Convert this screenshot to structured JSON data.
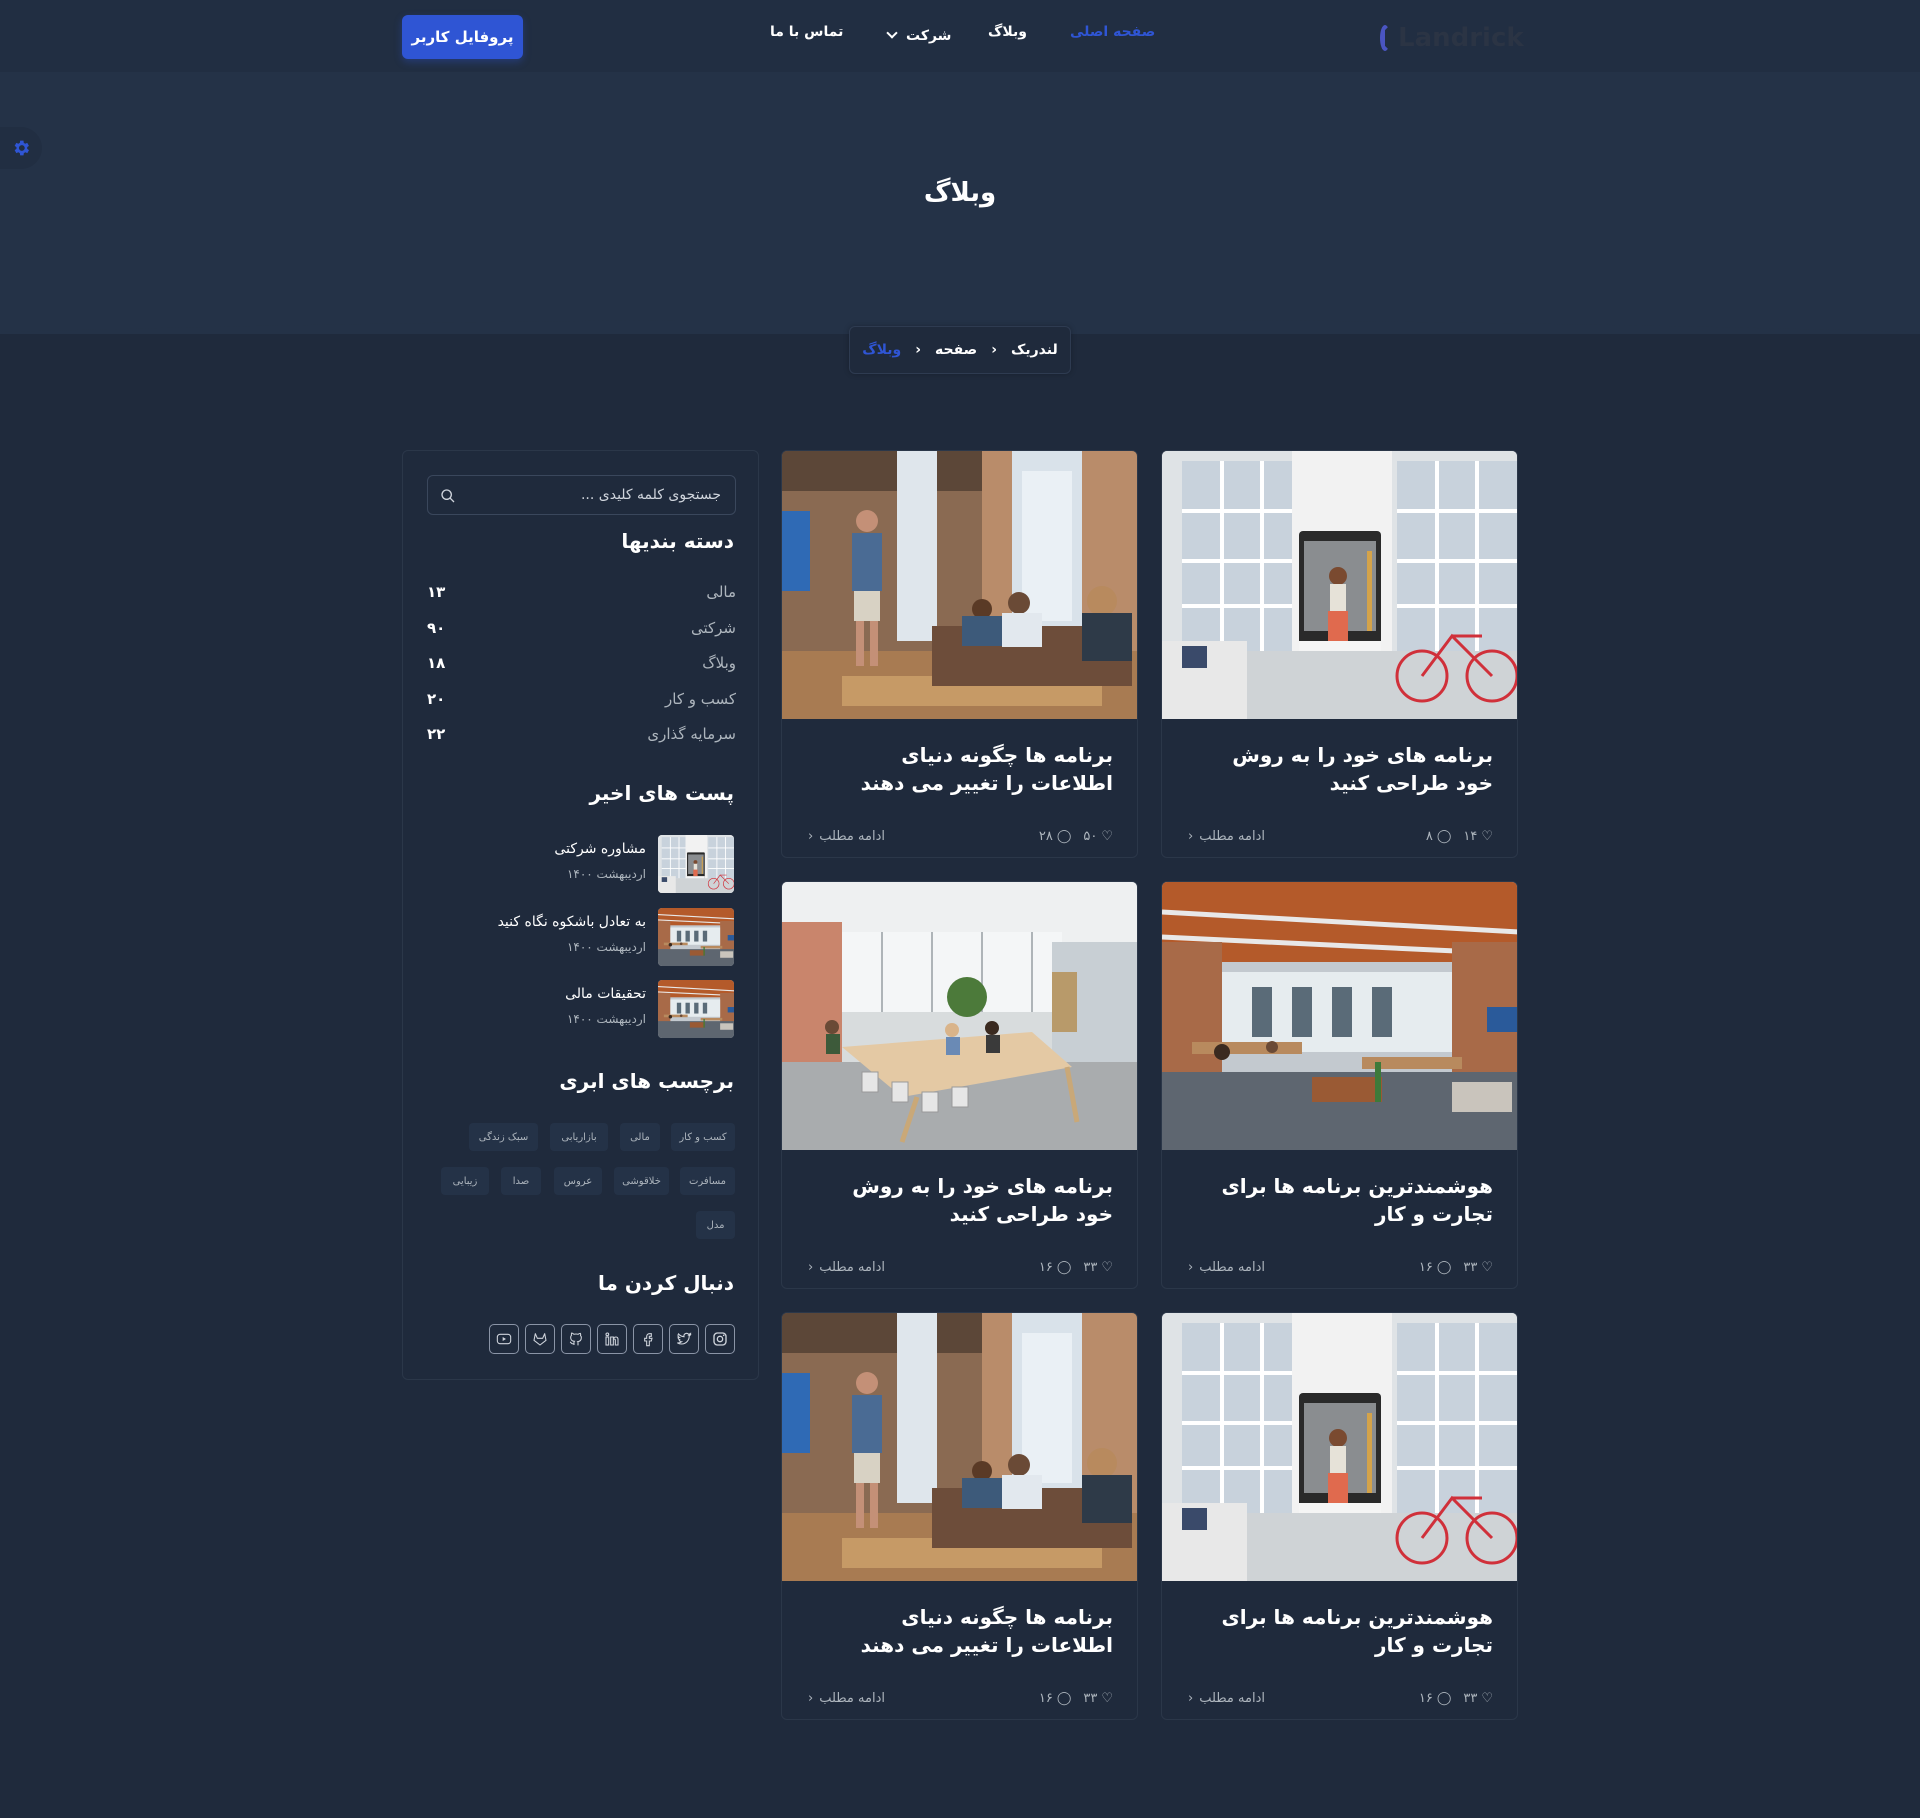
{
  "header": {
    "logo": "Landrick",
    "nav": {
      "home": "صفحه اصلی",
      "blog": "وبلاگ",
      "company": "شرکت",
      "contact": "تماس با ما"
    },
    "profile_button": "پروفایل کاربر"
  },
  "hero": {
    "title": "وبلاگ",
    "breadcrumb": [
      "لندریک",
      "صفحه",
      "وبلاگ"
    ]
  },
  "posts": [
    {
      "title": "برنامه های خود را به روش خود طراحی کنید",
      "likes": "۱۴",
      "comments": "۸",
      "read_more": "ادامه مطلب"
    },
    {
      "title": "برنامه ها چگونه دنیای اطلاعات را تغییر می دهند",
      "likes": "۵۰",
      "comments": "۲۸",
      "read_more": "ادامه مطلب"
    },
    {
      "title": "هوشمندترین برنامه ها برای تجارت و کار",
      "likes": "۳۳",
      "comments": "۱۶",
      "read_more": "ادامه مطلب"
    },
    {
      "title": "برنامه های خود را به روش خود طراحی کنید",
      "likes": "۳۳",
      "comments": "۱۶",
      "read_more": "ادامه مطلب"
    },
    {
      "title": "هوشمندترین برنامه ها برای تجارت و کار",
      "likes": "۳۳",
      "comments": "۱۶",
      "read_more": "ادامه مطلب"
    },
    {
      "title": "برنامه ها چگونه دنیای اطلاعات را تغییر می دهند",
      "likes": "۳۳",
      "comments": "۱۶",
      "read_more": "ادامه مطلب"
    }
  ],
  "sidebar": {
    "search_placeholder": "جستجوی کلمه کلیدی ...",
    "categories_title": "دسته بندیها",
    "categories": [
      {
        "name": "مالی",
        "count": "۱۳"
      },
      {
        "name": "شرکتی",
        "count": "۹۰"
      },
      {
        "name": "وبلاگ",
        "count": "۱۸"
      },
      {
        "name": "کسب و کار",
        "count": "۲۰"
      },
      {
        "name": "سرمایه گذاری",
        "count": "۲۲"
      }
    ],
    "recent_title": "پست های اخیر",
    "recent_posts": [
      {
        "title": "مشاوره شرکتی",
        "date": "اردیبهشت ۱۴۰۰"
      },
      {
        "title": "به تعادل باشکوه نگاه کنید",
        "date": "اردیبهشت ۱۴۰۰"
      },
      {
        "title": "تحقیقات مالی",
        "date": "اردیبهشت ۱۴۰۰"
      }
    ],
    "tags_title": "برچسب های ابری",
    "tags": [
      "کسب و کار",
      "مالی",
      "بازاریابی",
      "سبک زندگی",
      "مسافرت",
      "خلاقوشی",
      "عروس",
      "صدا",
      "زیبایی",
      "مدل"
    ],
    "follow_title": "دنبال کردن ما",
    "social_icons": [
      "instagram-icon",
      "twitter-icon",
      "facebook-icon",
      "linkedin-icon",
      "github-icon",
      "gitlab-icon",
      "youtube-icon"
    ]
  },
  "colors": {
    "accent": "#2f55d4",
    "background": "#1f2a3c",
    "hero": "#243247",
    "muted": "#adb5bd"
  }
}
